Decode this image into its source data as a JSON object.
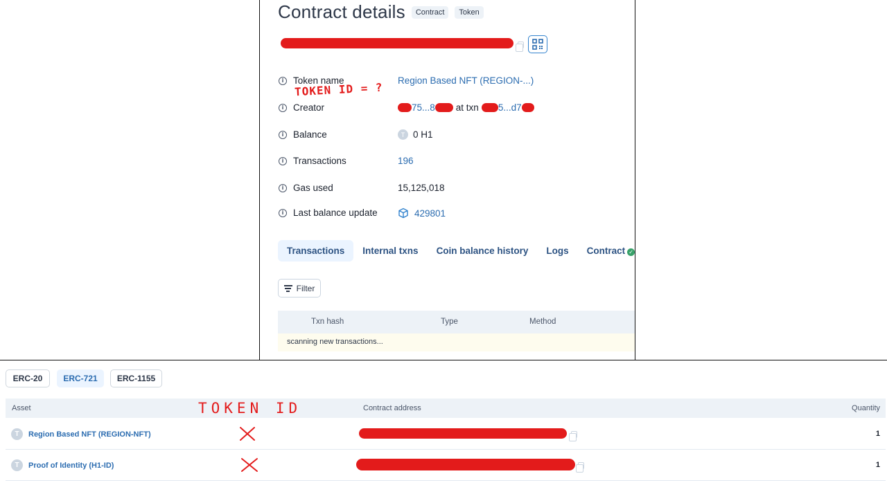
{
  "contract": {
    "title": "Contract details",
    "tags": [
      "Contract",
      "Token"
    ],
    "fields": [
      {
        "label": "Token name",
        "value": "Region Based NFT (REGION-...)"
      },
      {
        "label": "Creator",
        "value_parts": [
          "75...8",
          "at txn",
          "5...d7"
        ]
      },
      {
        "label": "Balance",
        "badge": "T",
        "value": "0 H1"
      },
      {
        "label": "Transactions",
        "value": "196"
      },
      {
        "label": "Gas used",
        "value": "15,125,018"
      },
      {
        "label": "Last balance update",
        "value": "429801"
      }
    ],
    "annotation": "TOKEN ID = ?",
    "tabs": [
      "Transactions",
      "Internal txns",
      "Coin balance history",
      "Logs",
      "Contract"
    ],
    "filter_label": "Filter",
    "txn_columns": [
      "Txn hash",
      "Type",
      "Method"
    ],
    "scanning_text": "scanning new transactions..."
  },
  "tokens": {
    "type_chips": [
      "ERC-20",
      "ERC-721",
      "ERC-1155"
    ],
    "selected_chip": "ERC-721",
    "columns": {
      "asset": "Asset",
      "contract": "Contract address",
      "quantity": "Quantity"
    },
    "annotation": "TOKEN ID",
    "rows": [
      {
        "badge": "T",
        "asset": "Region Based NFT (REGION-NFT)",
        "quantity": "1"
      },
      {
        "badge": "T",
        "asset": "Proof of Identity (H1-ID)",
        "quantity": "1"
      }
    ]
  }
}
